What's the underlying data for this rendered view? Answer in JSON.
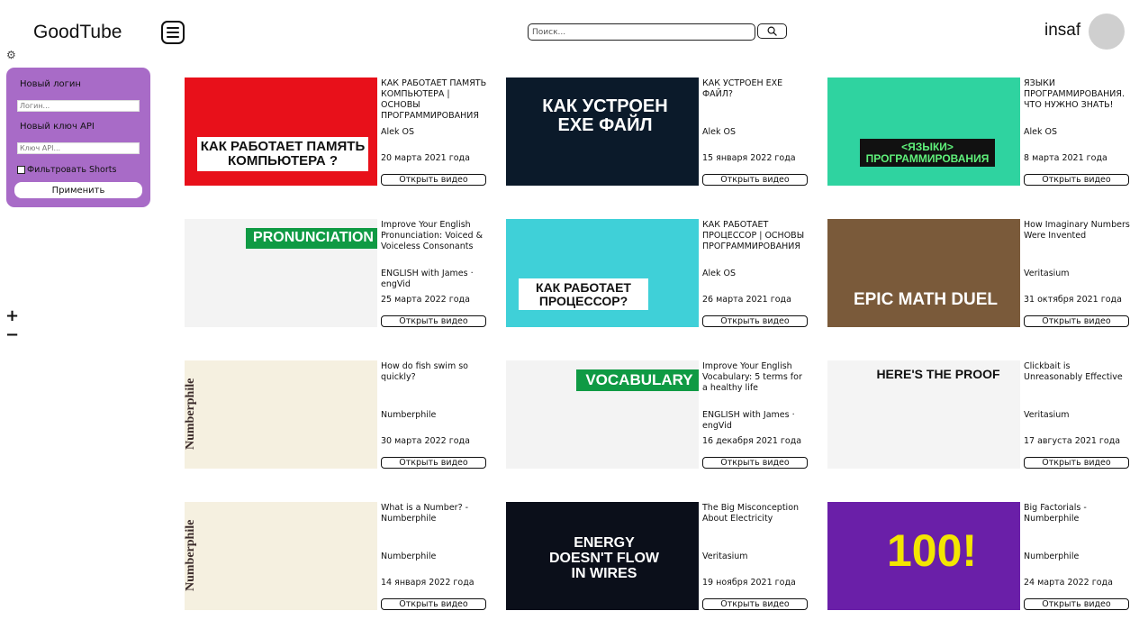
{
  "app": {
    "logo": "GoodTube",
    "username": "insaf"
  },
  "search": {
    "placeholder": "Поиск..."
  },
  "settings_panel": {
    "login_label": "Новый логин",
    "login_placeholder": "Логин...",
    "api_label": "Новый ключ API",
    "api_placeholder": "Ключ API...",
    "filter_shorts_label": "Фильтровать Shorts",
    "apply_label": "Применить"
  },
  "zoom": {
    "in": "+",
    "out": "−"
  },
  "icons": {
    "menu": "hamburger-icon",
    "search": "magnifier-icon",
    "settings": "gear-icon",
    "zoom_in": "plus-icon",
    "zoom_out": "minus-icon"
  },
  "colors": {
    "panel_bg": "#a86bc7",
    "avatar": "#cfcfcf"
  },
  "videos": [
    {
      "title": "КАК РАБОТАЕТ ПАМЯТЬ КОМПЬЮТЕРА | ОСНОВЫ ПРОГРАММИРОВАНИЯ",
      "channel": "Alek OS",
      "date": "20 марта 2021 года",
      "button": "Открыть видео",
      "thumb_text": "КАК РАБОТАЕТ ПАМЯТЬ КОМПЬЮТЕРА ?"
    },
    {
      "title": "КАК УСТРОЕН EXE ФАЙЛ?",
      "channel": "Alek OS",
      "date": "15 января 2022 года",
      "button": "Открыть видео",
      "thumb_text": "КАК УСТРОЕН EXE ФАЙЛ"
    },
    {
      "title": "ЯЗЫКИ ПРОГРАММИРОВАНИЯ. ЧТО НУЖНО ЗНАТЬ!",
      "channel": "Alek OS",
      "date": "8 марта 2021 года",
      "button": "Открыть видео",
      "thumb_text": "<ЯЗЫКИ> ПРОГРАММИРОВАНИЯ"
    },
    {
      "title": "Improve Your English Pronunciation: Voiced & Voiceless Consonants",
      "channel": "ENGLISH with James · engVid",
      "date": "25 марта 2022 года",
      "button": "Открыть видео",
      "thumb_text": "PRONUNCIATION"
    },
    {
      "title": "КАК РАБОТАЕТ ПРОЦЕССОР | ОСНОВЫ ПРОГРАММИРОВАНИЯ",
      "channel": "Alek OS",
      "date": "26 марта 2021 года",
      "button": "Открыть видео",
      "thumb_text": "КАК РАБОТАЕТ ПРОЦЕССОР?"
    },
    {
      "title": "How Imaginary Numbers Were Invented",
      "channel": "Veritasium",
      "date": "31 октября 2021 года",
      "button": "Открыть видео",
      "thumb_text": "EPIC MATH DUEL"
    },
    {
      "title": "How do fish swim so quickly?",
      "channel": "Numberphile",
      "date": "30 марта 2022 года",
      "button": "Открыть видео",
      "thumb_text": "Numberphile"
    },
    {
      "title": "Improve Your English Vocabulary: 5 terms for a healthy life",
      "channel": "ENGLISH with James · engVid",
      "date": "16 декабря 2021 года",
      "button": "Открыть видео",
      "thumb_text": "VOCABULARY"
    },
    {
      "title": "Clickbait is Unreasonably Effective",
      "channel": "Veritasium",
      "date": "17 августа 2021 года",
      "button": "Открыть видео",
      "thumb_text": "HERE'S THE PROOF"
    },
    {
      "title": "What is a Number? - Numberphile",
      "channel": "Numberphile",
      "date": "14 января 2022 года",
      "button": "Открыть видео",
      "thumb_text": "Numberphile"
    },
    {
      "title": "The Big Misconception About Electricity",
      "channel": "Veritasium",
      "date": "19 ноября 2021 года",
      "button": "Открыть видео",
      "thumb_text": "ENERGY DOESN'T FLOW IN WIRES"
    },
    {
      "title": "Big Factorials - Numberphile",
      "channel": "Numberphile",
      "date": "24 марта 2022 года",
      "button": "Открыть видео",
      "thumb_text": "100!"
    }
  ]
}
